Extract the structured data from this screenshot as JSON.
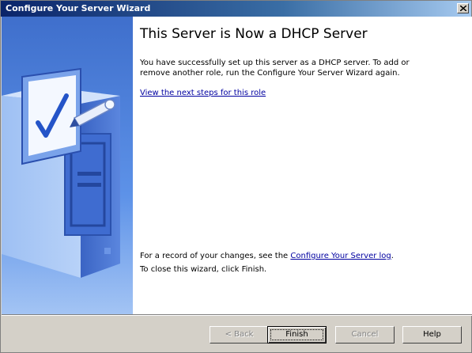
{
  "window": {
    "title": "Configure Your Server Wizard",
    "close_glyph": "×"
  },
  "page": {
    "heading": "This Server is Now a DHCP Server",
    "description": "You have successfully set up this server as a DHCP server. To add or remove another role, run the Configure Your Server Wizard again.",
    "next_steps_link": "View the next steps for this role",
    "record_prefix": "For a record of your changes, see the ",
    "record_link": "Configure Your Server log",
    "record_suffix": ".",
    "close_note": "To close this wizard, click Finish."
  },
  "buttons": {
    "back": "< Back",
    "finish": "Finish",
    "cancel": "Cancel",
    "help": "Help"
  },
  "icons": {
    "sidebar_art": "server-checklist-icon",
    "close": "close-icon"
  },
  "colors": {
    "title_start": "#0a246a",
    "title_end": "#a6caf0",
    "sidebar_blue": "#4b7fd8",
    "link": "#0000a0"
  }
}
